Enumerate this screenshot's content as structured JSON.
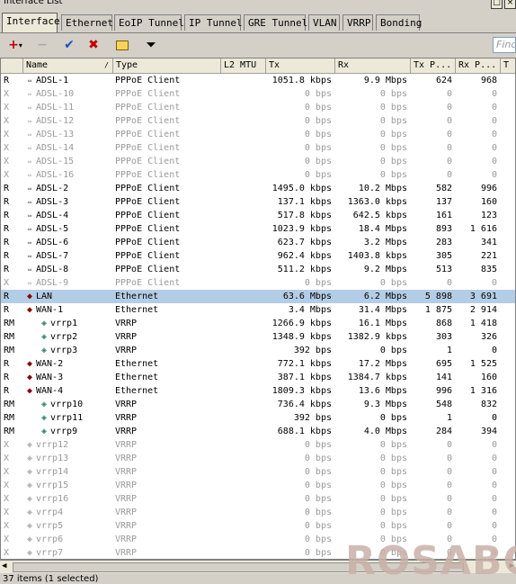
{
  "window": {
    "title": "Interface List"
  },
  "tabs": [
    "Interface",
    "Ethernet",
    "EoIP Tunnel",
    "IP Tunnel",
    "GRE Tunnel",
    "VLAN",
    "VRRP",
    "Bonding"
  ],
  "toolbar": {
    "find_placeholder": "Find"
  },
  "columns": [
    "Name",
    "Type",
    "L2 MTU",
    "Tx",
    "Rx",
    "Tx P...",
    "Rx P...",
    "T"
  ],
  "rows": [
    {
      "flag": "R",
      "name": "ADSL-1",
      "type": "PPPoE Client",
      "tx": "1051.8 kbps",
      "rx": "9.9 Mbps",
      "txp": "624",
      "rxp": "968"
    },
    {
      "flag": "X",
      "name": "ADSL-10",
      "type": "PPPoE Client",
      "tx": "0 bps",
      "rx": "0 bps",
      "txp": "0",
      "rxp": "0"
    },
    {
      "flag": "X",
      "name": "ADSL-11",
      "type": "PPPoE Client",
      "tx": "0 bps",
      "rx": "0 bps",
      "txp": "0",
      "rxp": "0"
    },
    {
      "flag": "X",
      "name": "ADSL-12",
      "type": "PPPoE Client",
      "tx": "0 bps",
      "rx": "0 bps",
      "txp": "0",
      "rxp": "0"
    },
    {
      "flag": "X",
      "name": "ADSL-13",
      "type": "PPPoE Client",
      "tx": "0 bps",
      "rx": "0 bps",
      "txp": "0",
      "rxp": "0"
    },
    {
      "flag": "X",
      "name": "ADSL-14",
      "type": "PPPoE Client",
      "tx": "0 bps",
      "rx": "0 bps",
      "txp": "0",
      "rxp": "0"
    },
    {
      "flag": "X",
      "name": "ADSL-15",
      "type": "PPPoE Client",
      "tx": "0 bps",
      "rx": "0 bps",
      "txp": "0",
      "rxp": "0"
    },
    {
      "flag": "X",
      "name": "ADSL-16",
      "type": "PPPoE Client",
      "tx": "0 bps",
      "rx": "0 bps",
      "txp": "0",
      "rxp": "0"
    },
    {
      "flag": "R",
      "name": "ADSL-2",
      "type": "PPPoE Client",
      "tx": "1495.0 kbps",
      "rx": "10.2 Mbps",
      "txp": "582",
      "rxp": "996"
    },
    {
      "flag": "R",
      "name": "ADSL-3",
      "type": "PPPoE Client",
      "tx": "137.1 kbps",
      "rx": "1363.0 kbps",
      "txp": "137",
      "rxp": "160"
    },
    {
      "flag": "R",
      "name": "ADSL-4",
      "type": "PPPoE Client",
      "tx": "517.8 kbps",
      "rx": "642.5 kbps",
      "txp": "161",
      "rxp": "123"
    },
    {
      "flag": "R",
      "name": "ADSL-5",
      "type": "PPPoE Client",
      "tx": "1023.9 kbps",
      "rx": "18.4 Mbps",
      "txp": "893",
      "rxp": "1 616"
    },
    {
      "flag": "R",
      "name": "ADSL-6",
      "type": "PPPoE Client",
      "tx": "623.7 kbps",
      "rx": "3.2 Mbps",
      "txp": "283",
      "rxp": "341"
    },
    {
      "flag": "R",
      "name": "ADSL-7",
      "type": "PPPoE Client",
      "tx": "962.4 kbps",
      "rx": "1403.8 kbps",
      "txp": "305",
      "rxp": "221"
    },
    {
      "flag": "R",
      "name": "ADSL-8",
      "type": "PPPoE Client",
      "tx": "511.2 kbps",
      "rx": "9.2 Mbps",
      "txp": "513",
      "rxp": "835"
    },
    {
      "flag": "X",
      "name": "ADSL-9",
      "type": "PPPoE Client",
      "tx": "0 bps",
      "rx": "0 bps",
      "txp": "0",
      "rxp": "0"
    },
    {
      "flag": "R",
      "name": "LAN",
      "type": "Ethernet",
      "tx": "63.6 Mbps",
      "rx": "6.2 Mbps",
      "txp": "5 898",
      "rxp": "3 691",
      "selected": true
    },
    {
      "flag": "R",
      "name": "WAN-1",
      "type": "Ethernet",
      "tx": "3.4 Mbps",
      "rx": "31.4 Mbps",
      "txp": "1 875",
      "rxp": "2 914"
    },
    {
      "flag": "RM",
      "name": "vrrp1",
      "type": "VRRP",
      "tx": "1266.9 kbps",
      "rx": "16.1 Mbps",
      "txp": "868",
      "rxp": "1 418",
      "indent": true
    },
    {
      "flag": "RM",
      "name": "vrrp2",
      "type": "VRRP",
      "tx": "1348.9 kbps",
      "rx": "1382.9 kbps",
      "txp": "303",
      "rxp": "326",
      "indent": true
    },
    {
      "flag": "RM",
      "name": "vrrp3",
      "type": "VRRP",
      "tx": "392 bps",
      "rx": "0 bps",
      "txp": "1",
      "rxp": "0",
      "indent": true
    },
    {
      "flag": "R",
      "name": "WAN-2",
      "type": "Ethernet",
      "tx": "772.1 kbps",
      "rx": "17.2 Mbps",
      "txp": "695",
      "rxp": "1 525"
    },
    {
      "flag": "R",
      "name": "WAN-3",
      "type": "Ethernet",
      "tx": "387.1 kbps",
      "rx": "1384.7 kbps",
      "txp": "141",
      "rxp": "160"
    },
    {
      "flag": "R",
      "name": "WAN-4",
      "type": "Ethernet",
      "tx": "1809.3 kbps",
      "rx": "13.6 Mbps",
      "txp": "996",
      "rxp": "1 316"
    },
    {
      "flag": "RM",
      "name": "vrrp10",
      "type": "VRRP",
      "tx": "736.4 kbps",
      "rx": "9.3 Mbps",
      "txp": "548",
      "rxp": "832",
      "indent": true
    },
    {
      "flag": "RM",
      "name": "vrrp11",
      "type": "VRRP",
      "tx": "392 bps",
      "rx": "0 bps",
      "txp": "1",
      "rxp": "0",
      "indent": true
    },
    {
      "flag": "RM",
      "name": "vrrp9",
      "type": "VRRP",
      "tx": "688.1 kbps",
      "rx": "4.0 Mbps",
      "txp": "284",
      "rxp": "394",
      "indent": true
    },
    {
      "flag": "X",
      "name": "vrrp12",
      "type": "VRRP",
      "tx": "0 bps",
      "rx": "0 bps",
      "txp": "0",
      "rxp": "0"
    },
    {
      "flag": "X",
      "name": "vrrp13",
      "type": "VRRP",
      "tx": "0 bps",
      "rx": "0 bps",
      "txp": "0",
      "rxp": "0"
    },
    {
      "flag": "X",
      "name": "vrrp14",
      "type": "VRRP",
      "tx": "0 bps",
      "rx": "0 bps",
      "txp": "0",
      "rxp": "0"
    },
    {
      "flag": "X",
      "name": "vrrp15",
      "type": "VRRP",
      "tx": "0 bps",
      "rx": "0 bps",
      "txp": "0",
      "rxp": "0"
    },
    {
      "flag": "X",
      "name": "vrrp16",
      "type": "VRRP",
      "tx": "0 bps",
      "rx": "0 bps",
      "txp": "0",
      "rxp": "0"
    },
    {
      "flag": "X",
      "name": "vrrp4",
      "type": "VRRP",
      "tx": "0 bps",
      "rx": "0 bps",
      "txp": "0",
      "rxp": "0"
    },
    {
      "flag": "X",
      "name": "vrrp5",
      "type": "VRRP",
      "tx": "0 bps",
      "rx": "0 bps",
      "txp": "0",
      "rxp": "0"
    },
    {
      "flag": "X",
      "name": "vrrp6",
      "type": "VRRP",
      "tx": "0 bps",
      "rx": "0 bps",
      "txp": "0",
      "rxp": "0"
    },
    {
      "flag": "X",
      "name": "vrrp7",
      "type": "VRRP",
      "tx": "0 bps",
      "rx": "0 bps",
      "txp": "0",
      "rxp": "0"
    }
  ],
  "status": "37 items (1 selected)",
  "watermark": "ROSABC",
  "colors": {
    "selected_row": "#b4cde6",
    "disabled_text": "#9a9a9a",
    "add_icon": "#c00000",
    "check_icon": "#1f4fbf"
  }
}
